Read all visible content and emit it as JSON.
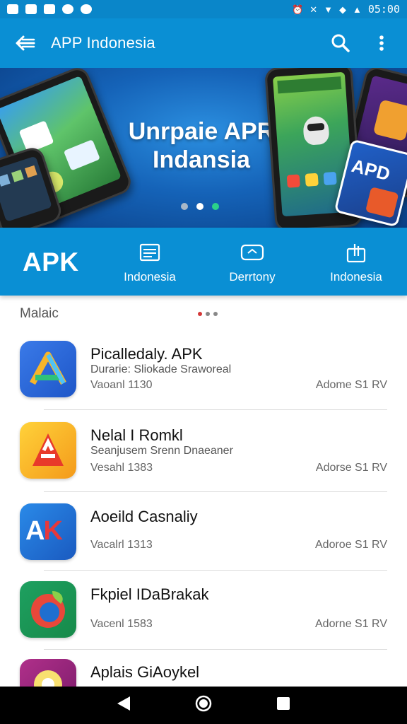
{
  "status_bar": {
    "time": "05:00"
  },
  "app_bar": {
    "title": "APP Indonesia"
  },
  "banner": {
    "title_line1": "Unrpaie APR",
    "title_line2": "Indansia",
    "active_slide": 2,
    "slide_count": 3
  },
  "categories": {
    "brand": "APK",
    "items": [
      {
        "label": "Indonesia",
        "icon": "list-icon"
      },
      {
        "label": "Derrtony",
        "icon": "folder-icon"
      },
      {
        "label": "Indonesia",
        "icon": "share-icon"
      }
    ]
  },
  "section": {
    "title": "Malaic"
  },
  "apps": [
    {
      "name": "Picalledaly. APK",
      "developer": "Durarie: Sliokade Sraworeal",
      "version": "Vaoanl 1130",
      "size": "Adome  S1 RV",
      "icon": "app-icon-a-blue"
    },
    {
      "name": "Nelal I Romkl",
      "developer": "Seanjusem Srenn Dnaeaner",
      "version": "Vesahl 1383",
      "size": "Adorse  S1 RV",
      "icon": "app-icon-a-red"
    },
    {
      "name": "Aoeild Casnaliy",
      "developer": "",
      "version": "Vacalrl 1313",
      "size": "Adoroe  S1 RV",
      "icon": "app-icon-ak"
    },
    {
      "name": "Fkpiel IDaBrakak",
      "developer": "",
      "version": "Vacenl 1583",
      "size": "Adorne  S1 RV",
      "icon": "app-icon-leaf"
    },
    {
      "name": "Aplais GiAoykel",
      "developer": "",
      "version": "",
      "size": "",
      "icon": "app-icon-flower"
    }
  ],
  "colors": {
    "primary": "#0a8fd4",
    "status": "#0a86c9",
    "banner_dark": "#0a3f86"
  }
}
